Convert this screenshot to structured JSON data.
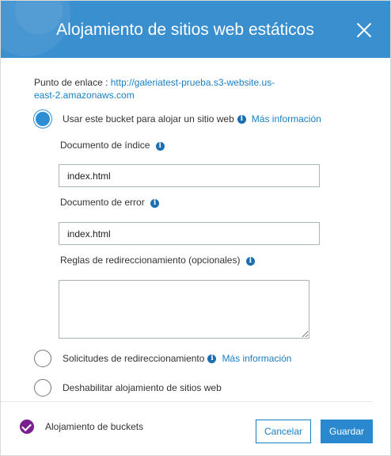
{
  "dialog": {
    "title": "Alojamiento de sitios web estáticos"
  },
  "endpoint": {
    "label": "Punto de enlace : ",
    "url": "http://galeriatest-prueba.s3-website.us-east-2.amazonaws.com"
  },
  "options": {
    "use_bucket": {
      "label": "Usar este bucket para alojar un sitio web",
      "more_info": "Más información",
      "selected": true
    },
    "redirect_requests": {
      "label": "Solicitudes de redireccionamiento",
      "more_info": "Más información",
      "selected": false
    },
    "disable_hosting": {
      "label": "Deshabilitar alojamiento de sitios web",
      "selected": false
    }
  },
  "fields": {
    "index_document": {
      "label": "Documento de índice",
      "value": "index.html"
    },
    "error_document": {
      "label": "Documento de error",
      "value": "index.html"
    },
    "redirect_rules": {
      "label": "Reglas de redireccionamiento (opcionales)",
      "value": ""
    }
  },
  "footer": {
    "status_label": "Alojamiento de buckets",
    "cancel_label": "Cancelar",
    "save_label": "Guardar"
  },
  "icons": {
    "info": "info-icon",
    "close": "close-icon",
    "status": "check-circle-icon"
  },
  "colors": {
    "header": "#3a8fcf",
    "link": "#1a7fc1",
    "primary_button": "#2a88cf",
    "status_check": "#7a1f8e"
  }
}
